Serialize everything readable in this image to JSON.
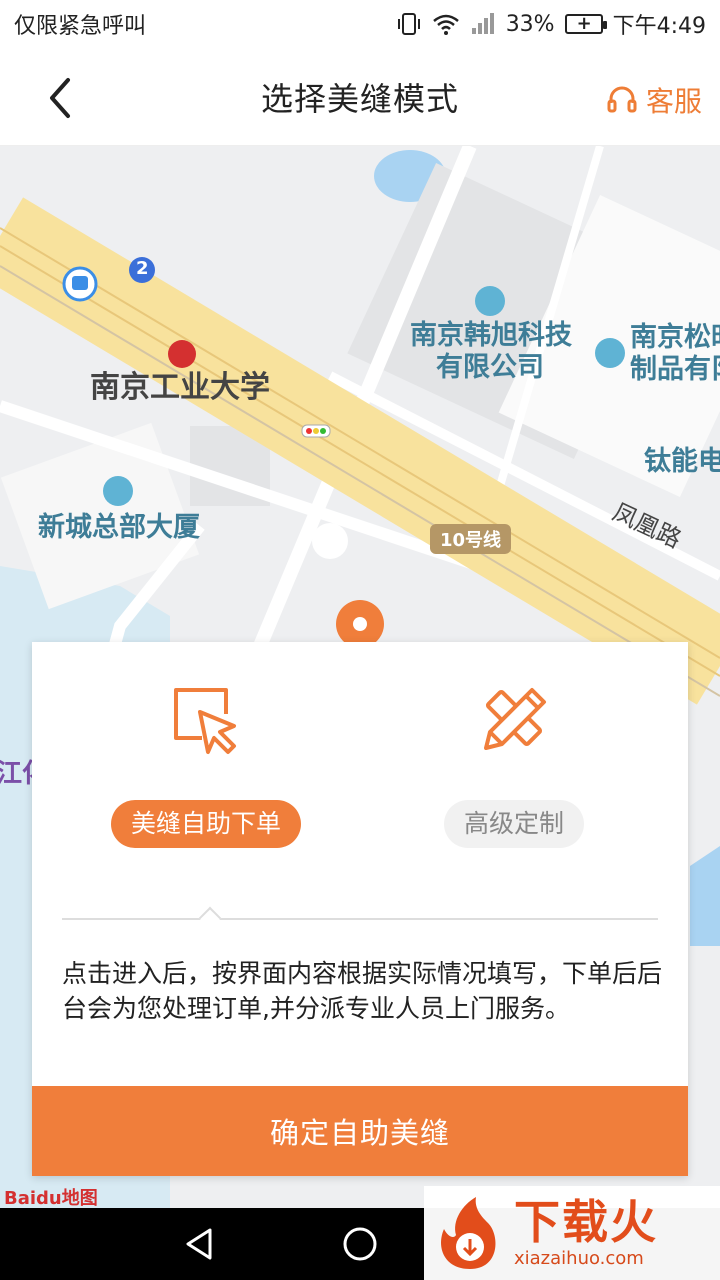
{
  "status_bar": {
    "left_text": "仅限紧急呼叫",
    "battery": "33%",
    "time": "下午4:49"
  },
  "header": {
    "title": "选择美缝模式",
    "service_label": "客服",
    "back_icon": "chevron-left-icon",
    "service_icon": "headset-icon"
  },
  "map": {
    "labels": {
      "university": "南京工业大学",
      "company1_line1": "南京韩旭科技",
      "company1_line2": "有限公司",
      "company2_line1": "南京松时",
      "company2_line2": "制品有阝",
      "building": "新城总部大厦",
      "titanium": "钛能电",
      "road": "凤凰路",
      "metro_line": "10号线",
      "bus_number": "2",
      "left_edge": "江化"
    },
    "provider": "Baidu地图"
  },
  "dialog": {
    "modes": [
      {
        "label": "美缝自助下单",
        "icon": "pointer-cursor-icon",
        "active": true
      },
      {
        "label": "高级定制",
        "icon": "pencil-ruler-icon",
        "active": false
      }
    ],
    "description": "点击进入后，按界面内容根据实际情况填写，下单后后台会为您处理订单,并分派专业人员上门服务。",
    "confirm_label": "确定自助美缝"
  },
  "watermark": {
    "title": "下载火",
    "url": "xiazaihuo.com"
  },
  "colors": {
    "accent": "#f07e3b",
    "road": "#f8e29d",
    "map_bg": "#eeeff1"
  }
}
